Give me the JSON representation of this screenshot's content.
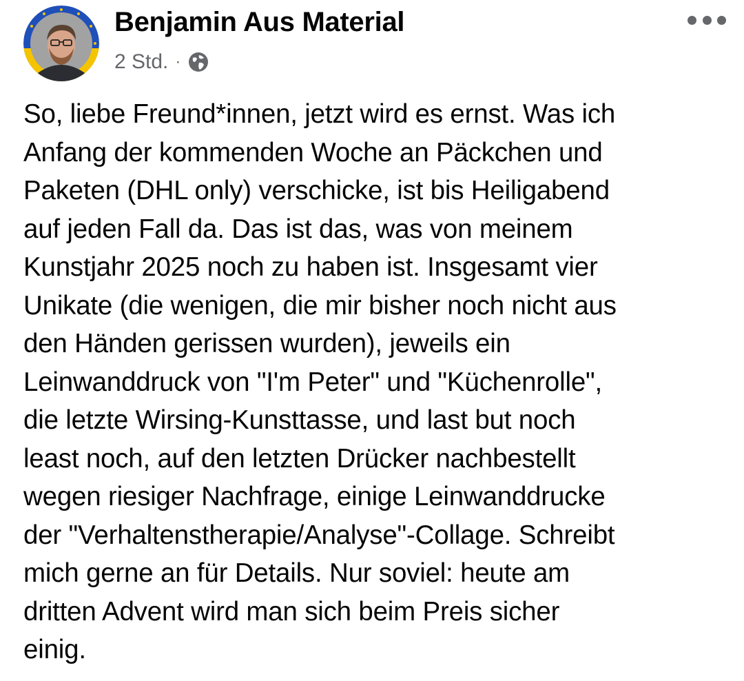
{
  "post": {
    "author": "Benjamin Aus Material",
    "time": "2 Std.",
    "separator": "·",
    "privacy_icon": "globe-icon",
    "more_icon": "more-options-icon",
    "text_lines": [
      "So, liebe Freund*innen, jetzt wird es ernst. Was ich",
      "Anfang der kommenden Woche an Päckchen und",
      "Paketen (DHL only) verschicke, ist bis Heiligabend",
      "auf jeden Fall da. Das ist das, was von meinem",
      "Kunstjahr 2025 noch zu haben ist. Insgesamt vier",
      "Unikate (die wenigen, die mir bisher noch nicht aus",
      "den Händen gerissen wurden), jeweils ein",
      "Leinwanddruck von \"I'm Peter\" und \"Küchenrolle\",",
      "die letzte Wirsing-Kunsttasse, und last but noch",
      "least noch, auf den letzten Drücker nachbestellt",
      "wegen riesiger Nachfrage, einige Leinwanddrucke",
      "der \"Verhaltenstherapie/Analyse\"-Collage. Schreibt",
      "mich gerne an für Details. Nur soviel: heute am",
      "dritten Advent wird man sich beim Preis sicher",
      "einig."
    ]
  },
  "colors": {
    "text": "#050505",
    "secondary": "#65676b",
    "avatar_ring_blue": "#1f4fb8",
    "avatar_ring_yellow": "#f5c400"
  }
}
